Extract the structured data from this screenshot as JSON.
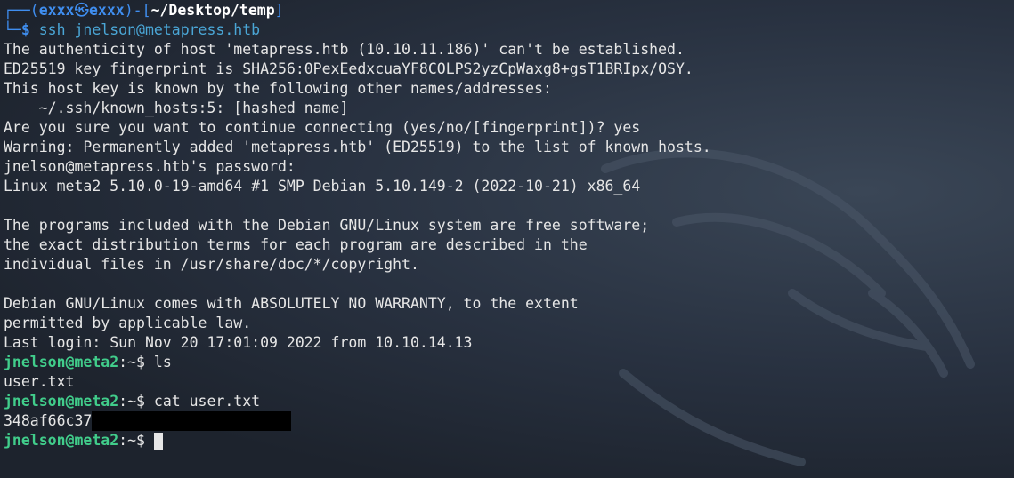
{
  "prompt": {
    "corner_top": "┌──(",
    "user": "exxx",
    "at_symbol": "㉿",
    "host": "exxx",
    "sep": ")-[",
    "path": "~/Desktop/temp",
    "close": "]",
    "corner_bottom": "└─",
    "dollar": "$",
    "command": "ssh jnelson@metapress.htb"
  },
  "output_lines": [
    "The authenticity of host 'metapress.htb (10.10.11.186)' can't be established.",
    "ED25519 key fingerprint is SHA256:0PexEedxcuaYF8COLPS2yzCpWaxg8+gsT1BRIpx/OSY.",
    "This host key is known by the following other names/addresses:",
    "    ~/.ssh/known_hosts:5: [hashed name]",
    "Are you sure you want to continue connecting (yes/no/[fingerprint])? yes",
    "Warning: Permanently added 'metapress.htb' (ED25519) to the list of known hosts.",
    "jnelson@metapress.htb's password:",
    "Linux meta2 5.10.0-19-amd64 #1 SMP Debian 5.10.149-2 (2022-10-21) x86_64",
    "",
    "The programs included with the Debian GNU/Linux system are free software;",
    "the exact distribution terms for each program are described in the",
    "individual files in /usr/share/doc/*/copyright.",
    "",
    "Debian GNU/Linux comes with ABSOLUTELY NO WARRANTY, to the extent",
    "permitted by applicable law.",
    "Last login: Sun Nov 20 17:01:09 2022 from 10.10.14.13"
  ],
  "remote_prompt": {
    "userhost": "jnelson@meta2",
    "rest": ":~$ "
  },
  "remote_cmds": {
    "cmd1": "ls",
    "out1": "user.txt",
    "cmd2": "cat user.txt",
    "out2_visible": "348af66c37"
  },
  "colors": {
    "background": "#1f2631",
    "prompt_blue": "#3f8ef0",
    "remote_green": "#41cd8b",
    "text": "#e6e6e6"
  }
}
